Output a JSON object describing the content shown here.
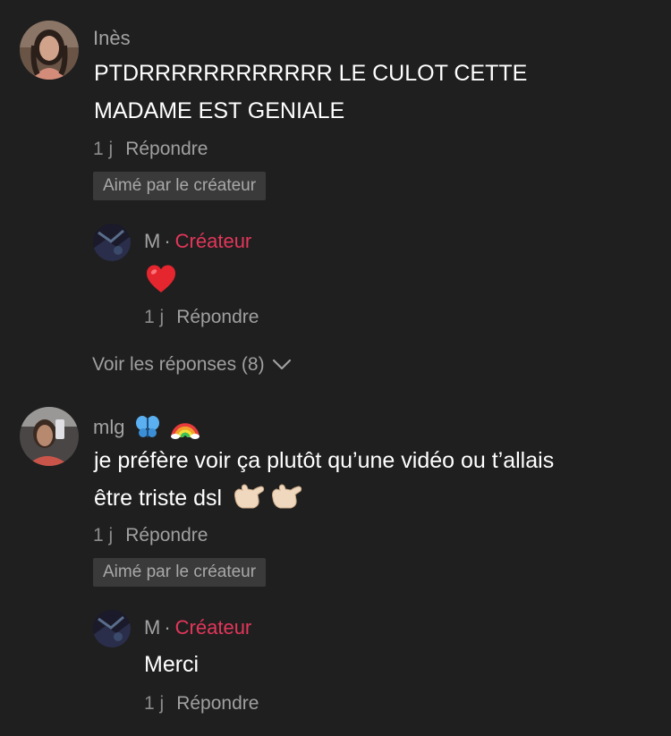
{
  "comments": [
    {
      "username": "Inès",
      "text_lines": [
        "PTDRRRRRRRRRRRR LE CULOT CETTE",
        "MADAME EST GENIALE"
      ],
      "time": "1 j",
      "reply_label": "Répondre",
      "liked_label": "Aimé par le créateur",
      "reply": {
        "username": "M",
        "separator": "·",
        "badge": "Créateur",
        "text": "",
        "emoji": "red-heart",
        "time": "1 j",
        "reply_label": "Répondre"
      },
      "view_replies_label": "Voir les réponses (8)"
    },
    {
      "username": "mlg",
      "username_emojis": [
        "butterfly",
        "rainbow"
      ],
      "text_lines": [
        "je préfère voir ça plutôt qu’une vidéo ou t’allais",
        "être triste dsl"
      ],
      "text_emojis": [
        "call-me-hand",
        "call-me-hand"
      ],
      "time": "1 j",
      "reply_label": "Répondre",
      "liked_label": "Aimé par le créateur",
      "reply": {
        "username": "M",
        "separator": "·",
        "badge": "Créateur",
        "text": "Merci",
        "time": "1 j",
        "reply_label": "Répondre"
      }
    }
  ],
  "colors": {
    "background": "#1f1f1f",
    "creator_badge": "#e3365a",
    "liked_badge_bg": "#3a3a3a",
    "muted_text": "#a3a3a3"
  }
}
